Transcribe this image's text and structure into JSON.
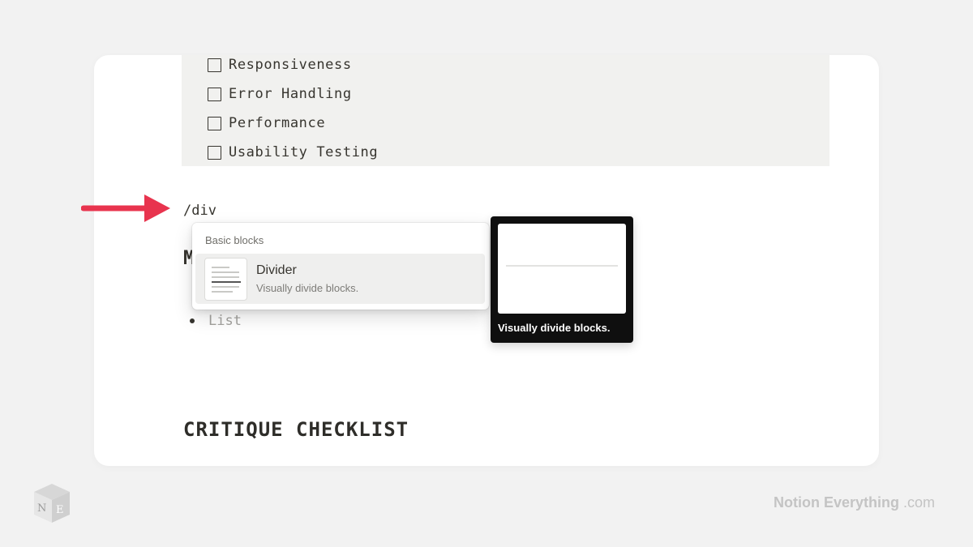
{
  "checklist": {
    "items": [
      {
        "label": "Responsiveness",
        "checked": false
      },
      {
        "label": "Error Handling",
        "checked": false
      },
      {
        "label": "Performance",
        "checked": false
      },
      {
        "label": "Usability Testing",
        "checked": false
      }
    ]
  },
  "editor": {
    "slash_command": "/div",
    "partial_heading": "M",
    "list_placeholder": "List",
    "section_heading": "CRITIQUE CHECKLIST"
  },
  "command_menu": {
    "section_label": "Basic blocks",
    "items": [
      {
        "title": "Divider",
        "description": "Visually divide blocks.",
        "icon": "divider-thumbnail-icon",
        "selected": true
      }
    ]
  },
  "preview": {
    "caption": "Visually divide blocks."
  },
  "branding": {
    "name": "Notion Everything",
    "suffix": ".com",
    "logo_icon": "notion-everything-cube-logo",
    "logo_letters": "NE"
  },
  "colors": {
    "arrow": "#e8344e",
    "page_bg": "#f2f2f2",
    "checklist_bg": "#f1f1ef",
    "selected_item_bg": "#efefee",
    "preview_bg": "#0f0f0f"
  }
}
